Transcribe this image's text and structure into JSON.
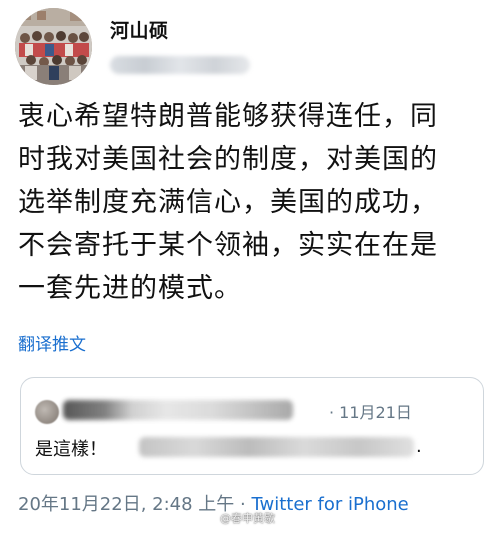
{
  "user": {
    "display_name": "河山硕"
  },
  "tweet": {
    "text_lines": [
      "衷心希望特朗普能够获得连任，同",
      "时我对美国社会的制度，对美国的",
      "选举制度充满信心，美国的成功，",
      "不会寄托于某个领袖，实实在在是",
      "一套先进的模式。"
    ],
    "translate_label": "翻译推文"
  },
  "quote": {
    "date": "· 11月21日",
    "text_prefix": "是這樣！",
    "text_suffix": "."
  },
  "footer": {
    "timestamp": "20年11月22日, 2:48 上午 · ",
    "source": "Twitter for iPhone"
  },
  "watermark": {
    "text": "@春申黄歇"
  },
  "colors": {
    "link": "#1a6fcf",
    "secondary_text": "#657786",
    "border": "#cfd6dc"
  }
}
